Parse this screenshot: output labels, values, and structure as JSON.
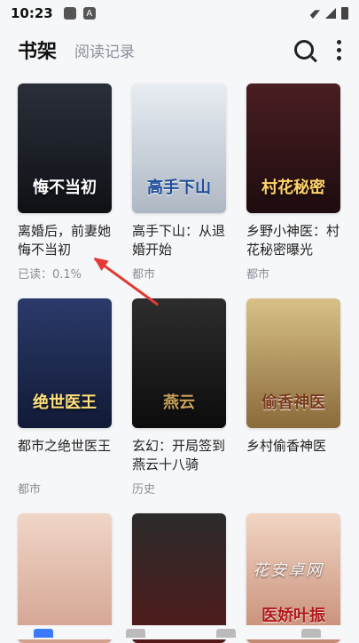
{
  "status": {
    "time": "10:23",
    "icon_a": "A"
  },
  "header": {
    "tab_active": "书架",
    "tab_inactive": "阅读记录"
  },
  "books": [
    {
      "title": "离婚后，前妻她悔不当初",
      "meta": "已读：0.1%",
      "cover_text": "悔不当初",
      "cover_top": "#2a2f3a",
      "cover_bottom": "#0f1115"
    },
    {
      "title": "高手下山：从退婚开始",
      "meta": "都市",
      "cover_text": "高手下山",
      "cover_top": "#e8edf2",
      "cover_bottom": "#aeb8c4"
    },
    {
      "title": "乡野小神医：村花秘密曝光",
      "meta": "都市",
      "cover_text": "村花秘密",
      "cover_top": "#4a1e22",
      "cover_bottom": "#1d0c0f"
    },
    {
      "title": "都市之绝世医王",
      "meta": "都市",
      "cover_text": "绝世医王",
      "cover_top": "#2b3a6a",
      "cover_bottom": "#111a36"
    },
    {
      "title": "玄幻：开局签到燕云十八骑",
      "meta": "历史",
      "cover_text": "燕云",
      "cover_top": "#2d2d2d",
      "cover_bottom": "#0c0c0c"
    },
    {
      "title": "乡村偷香神医",
      "meta": "",
      "cover_text": "偷香神医",
      "cover_top": "#d8c089",
      "cover_bottom": "#8a6b3a"
    },
    {
      "title": "",
      "meta": "",
      "cover_text": "",
      "cover_top": "#f0d6c8",
      "cover_bottom": "#d2a08d"
    },
    {
      "title": "",
      "meta": "",
      "cover_text": "",
      "cover_top": "#2b2b2b",
      "cover_bottom": "#541a1a"
    },
    {
      "title": "",
      "meta": "",
      "cover_text": "医娇叶振",
      "cover_top": "#f2d5c4",
      "cover_bottom": "#c48a73"
    }
  ],
  "watermark": "花安卓网",
  "colors": {
    "accent": "#e53935",
    "nav_active": "#3a7bfd"
  }
}
